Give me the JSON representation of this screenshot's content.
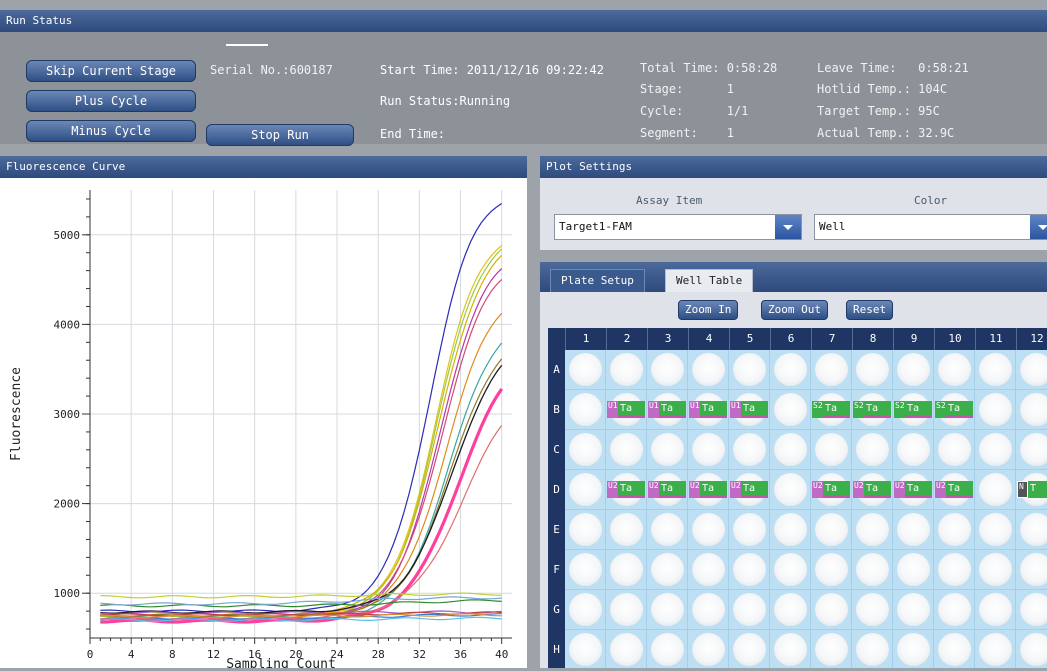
{
  "run_status": {
    "title": "Run Status",
    "buttons": {
      "skip": "Skip Current Stage",
      "plus": "Plus Cycle",
      "minus": "Minus Cycle",
      "stop": "Stop Run"
    },
    "serial": "Serial No.:600187",
    "start_time": "Start Time: 2011/12/16 09:22:42",
    "run_status_text": "Run Status:Running",
    "end_time": "End Time:",
    "total_time": "Total Time: 0:58:28",
    "stage": "Stage:      1",
    "cycle": "Cycle:      1/1",
    "segment": "Segment:    1",
    "leave_time": "Leave Time:   0:58:21",
    "hotlid": "Hotlid Temp.: 104C",
    "target_temp": "Target Temp.: 95C",
    "actual_temp": "Actual Temp.: 32.9C"
  },
  "fluorescence": {
    "title": "Fluorescence Curve"
  },
  "plot_settings": {
    "title": "Plot Settings",
    "assay_label": "Assay Item",
    "color_label": "Color",
    "assay_value": "Target1-FAM",
    "color_value": "Well"
  },
  "plate": {
    "tabs": [
      "Plate Setup",
      "Well Table"
    ],
    "zoom_in": "Zoom In",
    "zoom_out": "Zoom Out",
    "reset": "Reset",
    "columns": [
      "1",
      "2",
      "3",
      "4",
      "5",
      "6",
      "7",
      "8",
      "9",
      "10",
      "11",
      "12"
    ],
    "rows": [
      "A",
      "B",
      "C",
      "D",
      "E",
      "F",
      "G",
      "H"
    ],
    "wells": [
      {
        "row": "B",
        "col": 2,
        "type": "s1",
        "cls": "U1",
        "name": "Ta"
      },
      {
        "row": "B",
        "col": 3,
        "type": "s1",
        "cls": "U1",
        "name": "Ta"
      },
      {
        "row": "B",
        "col": 4,
        "type": "s1",
        "cls": "U1",
        "name": "Ta"
      },
      {
        "row": "B",
        "col": 5,
        "type": "s1",
        "cls": "U1",
        "name": "Ta"
      },
      {
        "row": "B",
        "col": 7,
        "type": "s2",
        "cls": "S2",
        "name": "Ta"
      },
      {
        "row": "B",
        "col": 8,
        "type": "s2",
        "cls": "S2",
        "name": "Ta"
      },
      {
        "row": "B",
        "col": 9,
        "type": "s2",
        "cls": "S2",
        "name": "Ta"
      },
      {
        "row": "B",
        "col": 10,
        "type": "s2",
        "cls": "S2",
        "name": "Ta"
      },
      {
        "row": "D",
        "col": 2,
        "type": "s1",
        "cls": "U2",
        "name": "Ta"
      },
      {
        "row": "D",
        "col": 3,
        "type": "s1",
        "cls": "U2",
        "name": "Ta"
      },
      {
        "row": "D",
        "col": 4,
        "type": "s1",
        "cls": "U2",
        "name": "Ta"
      },
      {
        "row": "D",
        "col": 5,
        "type": "s1",
        "cls": "U2",
        "name": "Ta"
      },
      {
        "row": "D",
        "col": 7,
        "type": "s1",
        "cls": "U2",
        "name": "Ta"
      },
      {
        "row": "D",
        "col": 8,
        "type": "s1",
        "cls": "U2",
        "name": "Ta"
      },
      {
        "row": "D",
        "col": 9,
        "type": "s1",
        "cls": "U2",
        "name": "Ta"
      },
      {
        "row": "D",
        "col": 10,
        "type": "s1",
        "cls": "U2",
        "name": "Ta"
      },
      {
        "row": "D",
        "col": 12,
        "type": "n",
        "cls": "N",
        "name": "T"
      }
    ]
  },
  "chart_data": {
    "type": "line",
    "title": "",
    "xlabel": "Sampling Count",
    "ylabel": "Fluorescence",
    "xlim": [
      0,
      41
    ],
    "ylim": [
      500,
      5500
    ],
    "xticks": [
      0,
      4,
      8,
      12,
      16,
      20,
      24,
      28,
      32,
      36,
      40
    ],
    "yticks": [
      1000,
      2000,
      3000,
      4000,
      5000
    ],
    "grid": true,
    "series": [
      {
        "color": "#2b2bb8",
        "width": 1.2,
        "base": 800,
        "plateau": 5520,
        "mid": 33.0,
        "k": 0.48
      },
      {
        "color": "#e0c21a",
        "width": 1.2,
        "base": 760,
        "plateau": 5080,
        "mid": 33.6,
        "k": 0.48
      },
      {
        "color": "#9acb46",
        "width": 1.2,
        "base": 740,
        "plateau": 5050,
        "mid": 33.7,
        "k": 0.47
      },
      {
        "color": "#d6b200",
        "width": 1.2,
        "base": 780,
        "plateau": 5000,
        "mid": 33.9,
        "k": 0.46
      },
      {
        "color": "#b23aa8",
        "width": 1.2,
        "base": 720,
        "plateau": 4860,
        "mid": 34.0,
        "k": 0.46
      },
      {
        "color": "#d2487a",
        "width": 1.2,
        "base": 760,
        "plateau": 4780,
        "mid": 34.2,
        "k": 0.45
      },
      {
        "color": "#e08a1a",
        "width": 1.2,
        "base": 740,
        "plateau": 4450,
        "mid": 34.6,
        "k": 0.44
      },
      {
        "color": "#3aa8a0",
        "width": 1.2,
        "base": 700,
        "plateau": 4150,
        "mid": 34.9,
        "k": 0.43
      },
      {
        "color": "#8e7a2a",
        "width": 1.2,
        "base": 750,
        "plateau": 3950,
        "mid": 35.0,
        "k": 0.43
      },
      {
        "color": "#1a1a2a",
        "width": 1.3,
        "base": 790,
        "plateau": 3900,
        "mid": 35.2,
        "k": 0.42
      },
      {
        "color": "#ff3f9e",
        "width": 3.2,
        "base": 690,
        "plateau": 3750,
        "mid": 35.8,
        "k": 0.4
      },
      {
        "color": "#e0706a",
        "width": 1.2,
        "base": 720,
        "plateau": 3400,
        "mid": 36.3,
        "k": 0.38
      },
      {
        "color": "#2e8a2e",
        "width": 1.2,
        "base": 860,
        "plateau": 920,
        "mid": 30,
        "k": 0.3
      },
      {
        "color": "#bfcf30",
        "width": 1.2,
        "base": 960,
        "plateau": 990,
        "mid": 25,
        "k": 0.3
      },
      {
        "color": "#7aa6d8",
        "width": 1.2,
        "base": 880,
        "plateau": 950,
        "mid": 25,
        "k": 0.3
      },
      {
        "color": "#a05cc8",
        "width": 1.2,
        "base": 780,
        "plateau": 790,
        "mid": 25,
        "k": 0.3
      },
      {
        "color": "#3a7ad8",
        "width": 1.2,
        "base": 720,
        "plateau": 760,
        "mid": 28,
        "k": 0.3
      },
      {
        "color": "#c04040",
        "width": 1.2,
        "base": 760,
        "plateau": 780,
        "mid": 28,
        "k": 0.3
      },
      {
        "color": "#58c0e8",
        "width": 1.2,
        "base": 700,
        "plateau": 720,
        "mid": 28,
        "k": 0.3
      },
      {
        "color": "#d89030",
        "width": 1.2,
        "base": 740,
        "plateau": 760,
        "mid": 28,
        "k": 0.3
      }
    ]
  }
}
